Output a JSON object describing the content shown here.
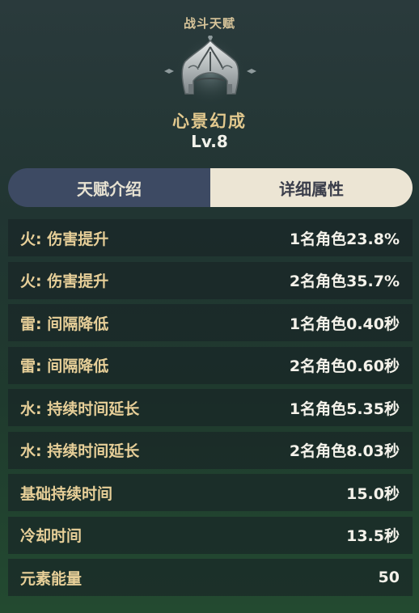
{
  "header": {
    "category": "战斗天赋",
    "talent_name": "心景幻成",
    "level": "Lv.8"
  },
  "tabs": [
    {
      "label": "天赋介绍",
      "active": false
    },
    {
      "label": "详细属性",
      "active": true
    }
  ],
  "attributes": [
    {
      "label": "火: 伤害提升",
      "value": "1名角色23.8%"
    },
    {
      "label": "火: 伤害提升",
      "value": "2名角色35.7%"
    },
    {
      "label": "雷: 间隔降低",
      "value": "1名角色0.40秒"
    },
    {
      "label": "雷: 间隔降低",
      "value": "2名角色0.60秒"
    },
    {
      "label": "水: 持续时间延长",
      "value": "1名角色5.35秒"
    },
    {
      "label": "水: 持续时间延长",
      "value": "2名角色8.03秒"
    },
    {
      "label": "基础持续时间",
      "value": "15.0秒"
    },
    {
      "label": "冷却时间",
      "value": "13.5秒"
    },
    {
      "label": "元素能量",
      "value": "50"
    }
  ],
  "icons": {
    "talent_emblem": "talent-emblem-icon"
  },
  "colors": {
    "gold_text": "#e7cf98",
    "tab_active_bg": "#ece5d4",
    "tab_inactive_bg": "#3d4a63"
  }
}
